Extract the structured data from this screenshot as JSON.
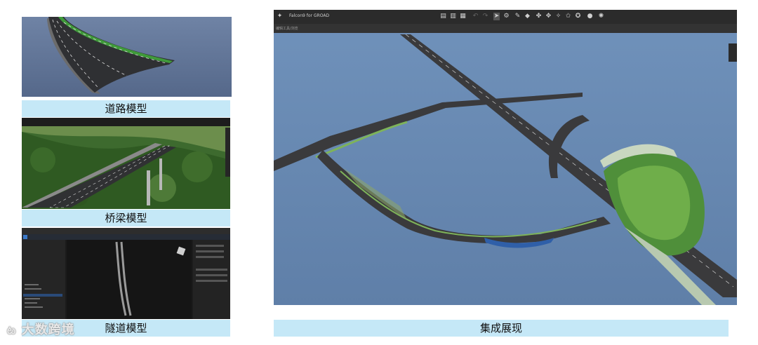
{
  "captions": {
    "road": "道路模型",
    "bridge": "桥梁模型",
    "tunnel": "隧道模型",
    "integrated": "集成展现"
  },
  "app": {
    "title": "Falcon9 for GROAD",
    "subtitle": "编辑工具/浏览"
  },
  "watermark": "大数跨境",
  "colors": {
    "caption_bg": "#c5e8f7",
    "sky": "#6f8eb4",
    "toolbar": "#2b2b2b"
  }
}
